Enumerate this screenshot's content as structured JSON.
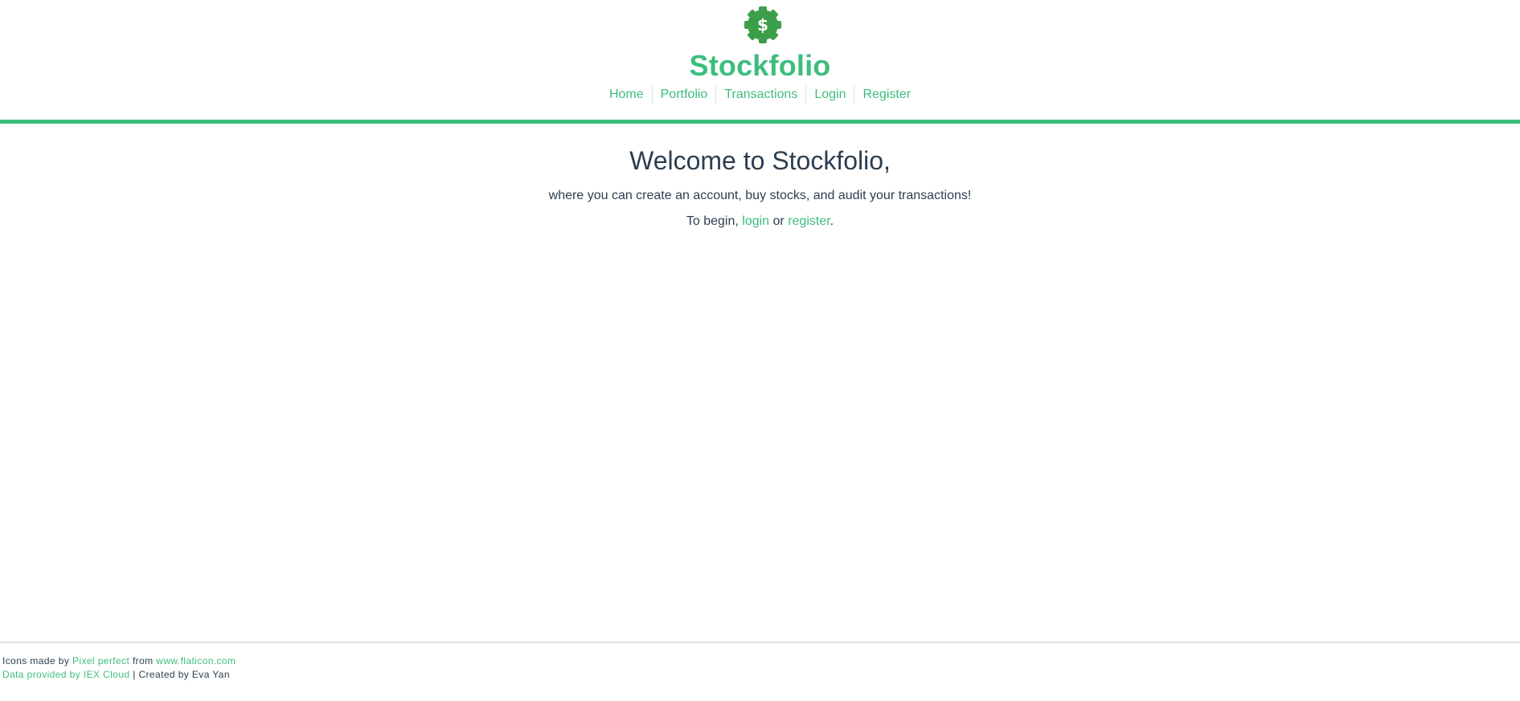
{
  "header": {
    "brand": "Stockfolio",
    "logo_icon": "gear-dollar-icon",
    "accent_color": "#3dbd7d",
    "nav": [
      {
        "label": "Home"
      },
      {
        "label": "Portfolio"
      },
      {
        "label": "Transactions"
      },
      {
        "label": "Login"
      },
      {
        "label": "Register"
      }
    ]
  },
  "main": {
    "title": "Welcome to Stockfolio,",
    "subtitle": "where you can create an account, buy stocks, and audit your transactions!",
    "begin_prefix": "To begin, ",
    "login_link": "login",
    "or_text": " or ",
    "register_link": "register",
    "begin_suffix": "."
  },
  "footer": {
    "line1_prefix": "Icons made by ",
    "pixel_perfect": "Pixel perfect",
    "line1_mid": " from ",
    "flaticon": "www.flaticon.com",
    "iex_link": "Data provided by IEX Cloud",
    "line2_suffix": " | Created by Eva Yan"
  }
}
